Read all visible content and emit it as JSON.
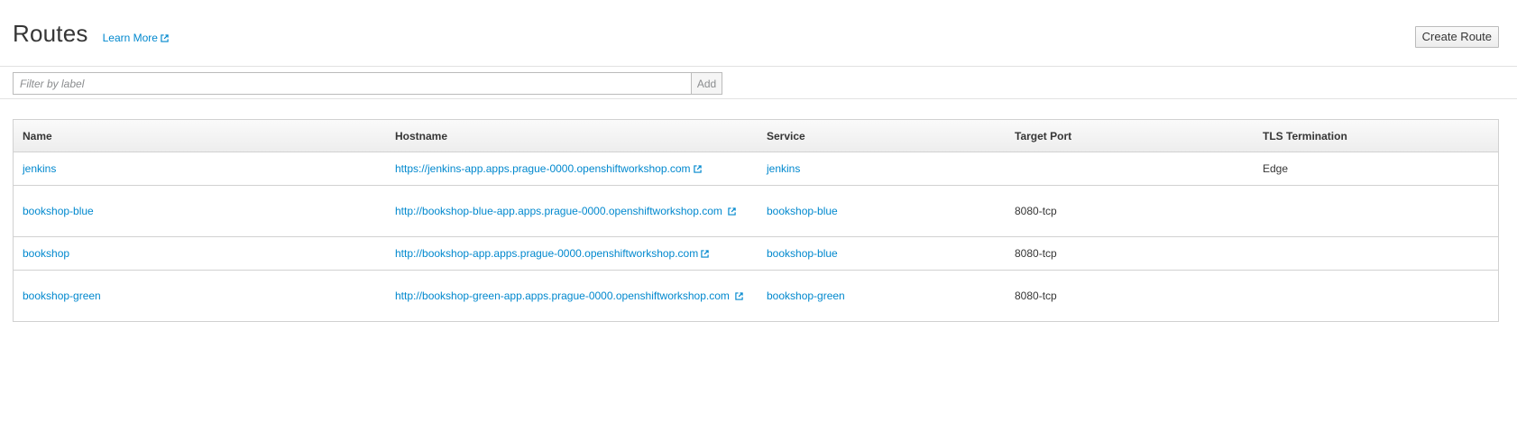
{
  "header": {
    "title": "Routes",
    "learn_more": "Learn More",
    "create_button": "Create Route"
  },
  "filter": {
    "placeholder": "Filter by label",
    "value": "",
    "add_button": "Add"
  },
  "table": {
    "columns": [
      "Name",
      "Hostname",
      "Service",
      "Target Port",
      "TLS Termination"
    ],
    "rows": [
      {
        "name": "jenkins",
        "hostname": "https://jenkins-app.apps.prague-0000.openshiftworkshop.com",
        "service": "jenkins",
        "target_port": "",
        "tls_termination": "Edge"
      },
      {
        "name": "bookshop-blue",
        "hostname": "http://bookshop-blue-app.apps.prague-0000.openshiftworkshop.com",
        "service": "bookshop-blue",
        "target_port": "8080-tcp",
        "tls_termination": ""
      },
      {
        "name": "bookshop",
        "hostname": "http://bookshop-app.apps.prague-0000.openshiftworkshop.com",
        "service": "bookshop-blue",
        "target_port": "8080-tcp",
        "tls_termination": ""
      },
      {
        "name": "bookshop-green",
        "hostname": "http://bookshop-green-app.apps.prague-0000.openshiftworkshop.com",
        "service": "bookshop-green",
        "target_port": "8080-tcp",
        "tls_termination": ""
      }
    ]
  },
  "icons": {
    "external_link": "external-link-icon"
  },
  "colors": {
    "link": "#0088ce",
    "text": "#363636",
    "border": "#d1d1d1"
  }
}
